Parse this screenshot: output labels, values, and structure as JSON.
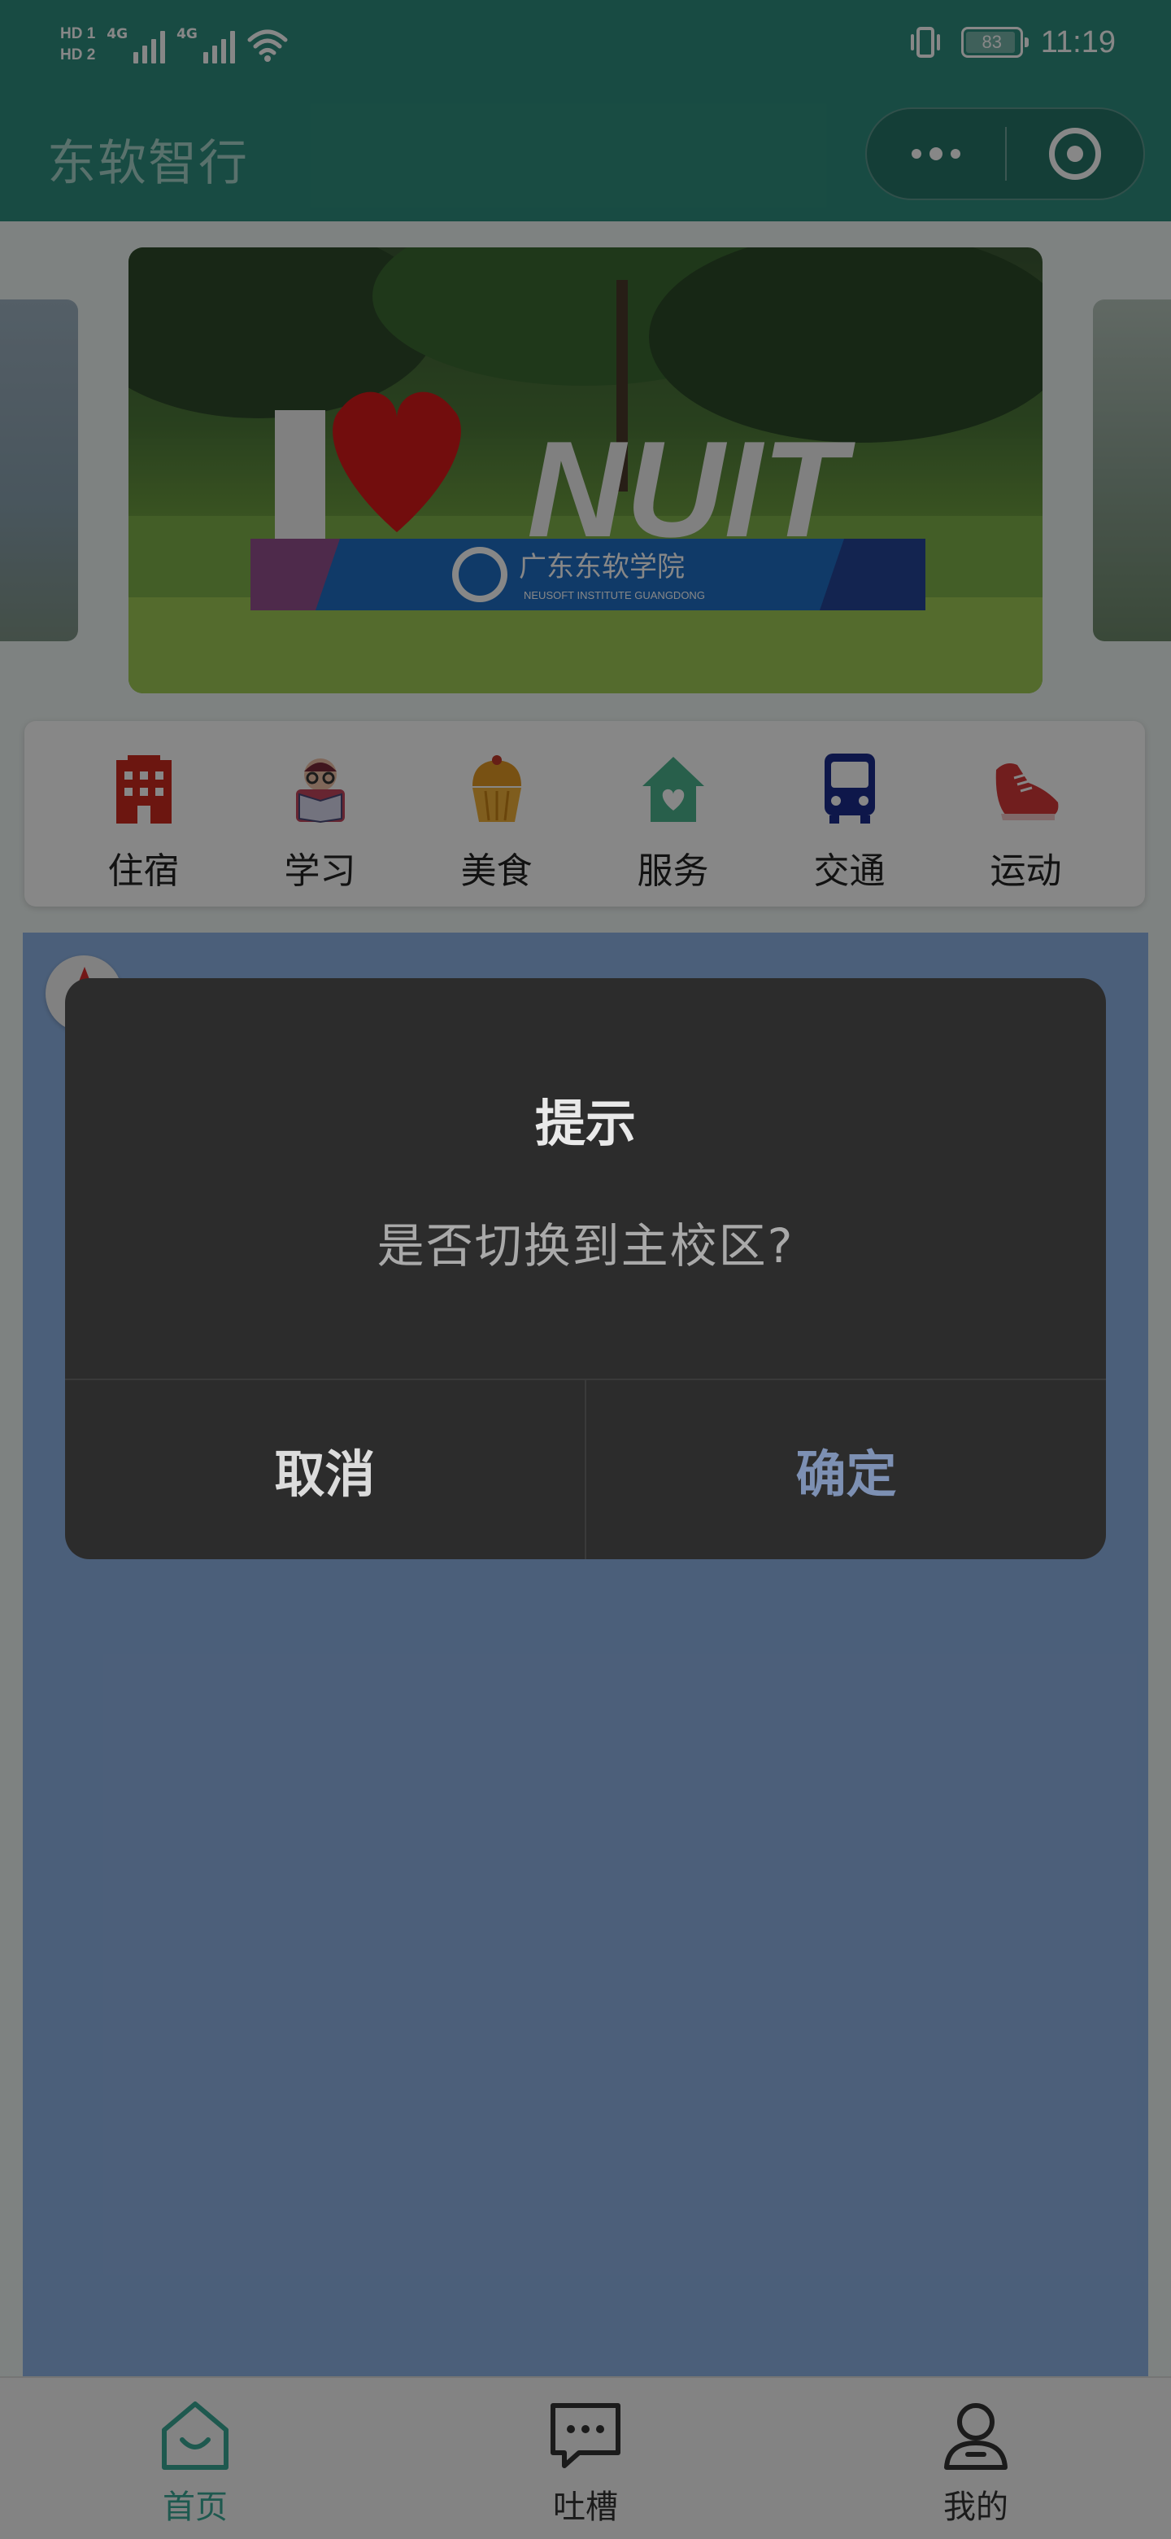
{
  "status_bar": {
    "hd1": "HD 1",
    "hd2": "HD 2",
    "net1": "4G",
    "net2": "4G",
    "battery": "83",
    "time": "11:19"
  },
  "navbar": {
    "title": "东软智行"
  },
  "banner": {
    "sign_text": "NUIT",
    "sign_sub": "广东东软学院",
    "sign_en": "NEUSOFT INSTITUTE GUANGDONG"
  },
  "categories": [
    {
      "label": "住宿",
      "icon": "building-icon",
      "color": "#cc2b1f"
    },
    {
      "label": "学习",
      "icon": "reading-icon",
      "color": "#c2475e"
    },
    {
      "label": "美食",
      "icon": "cupcake-icon",
      "color": "#e39a25"
    },
    {
      "label": "服务",
      "icon": "house-heart-icon",
      "color": "#4db38f"
    },
    {
      "label": "交通",
      "icon": "bus-icon",
      "color": "#1c2d8c"
    },
    {
      "label": "运动",
      "icon": "sneaker-icon",
      "color": "#d63a3a"
    }
  ],
  "tabbar": {
    "items": [
      {
        "label": "首页",
        "icon": "home-icon",
        "active": true
      },
      {
        "label": "吐槽",
        "icon": "chat-icon",
        "active": false
      },
      {
        "label": "我的",
        "icon": "user-icon",
        "active": false
      }
    ],
    "active_color": "#3aa896"
  },
  "dialog": {
    "title": "提示",
    "message": "是否切换到主校区?",
    "cancel": "取消",
    "confirm": "确定"
  }
}
